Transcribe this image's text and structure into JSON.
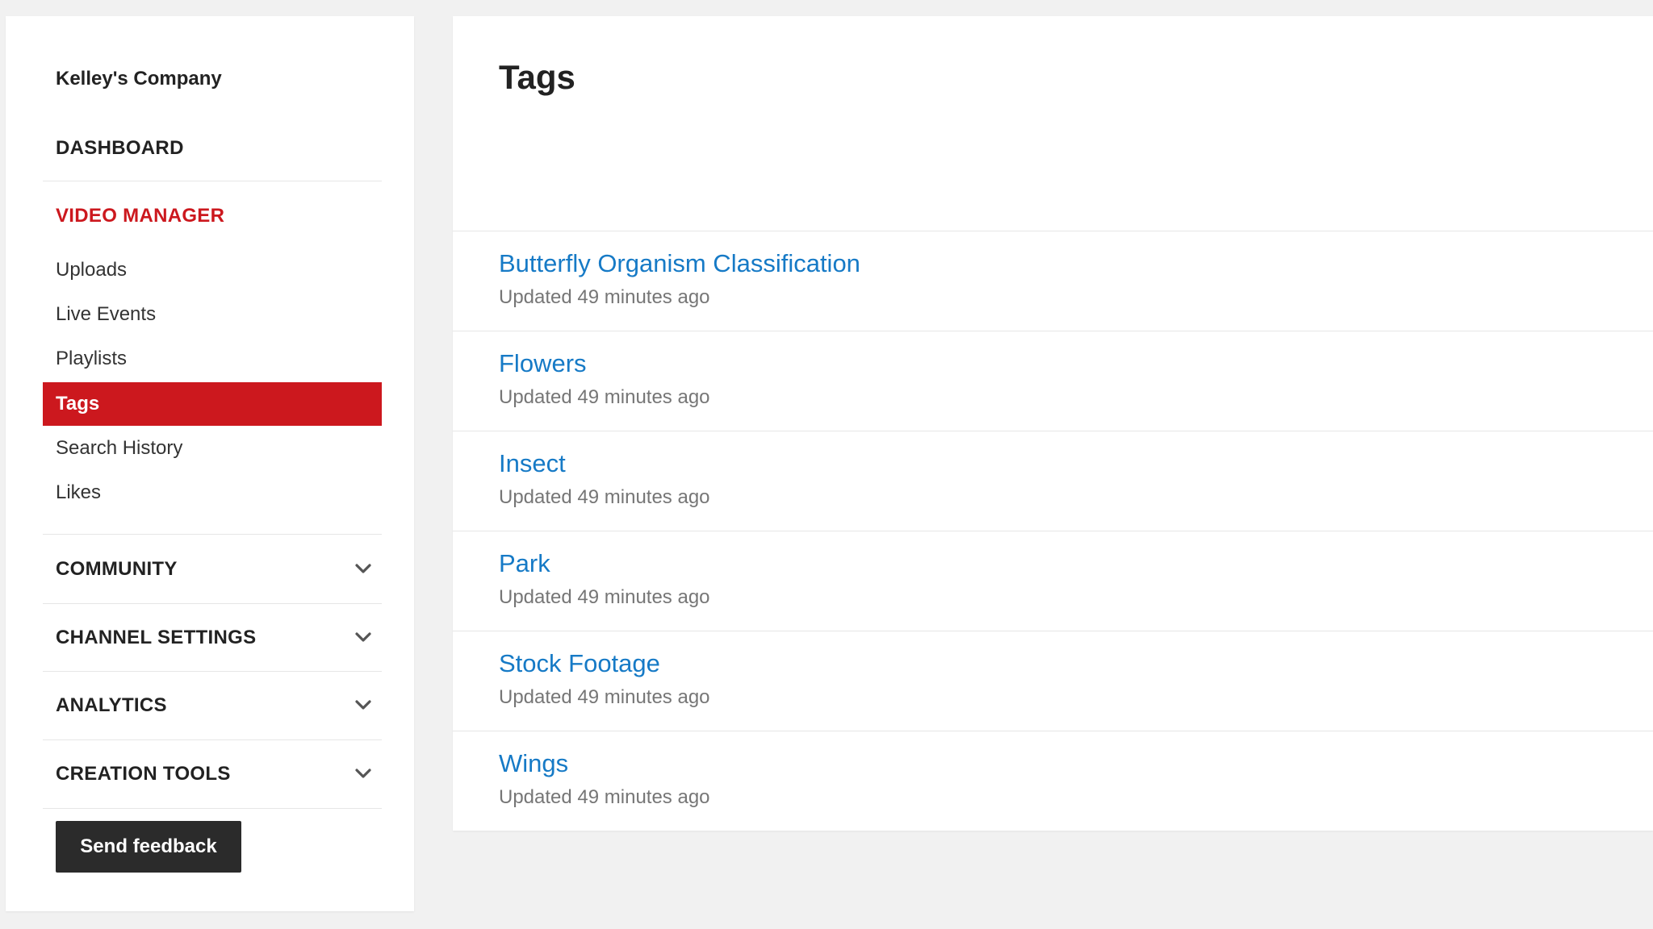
{
  "sidebar": {
    "company": "Kelley's Company",
    "dashboard": "DASHBOARD",
    "video_manager": "VIDEO MANAGER",
    "items": [
      {
        "label": "Uploads"
      },
      {
        "label": "Live Events"
      },
      {
        "label": "Playlists"
      },
      {
        "label": "Tags",
        "active": true
      },
      {
        "label": "Search History"
      },
      {
        "label": "Likes"
      }
    ],
    "sections": [
      {
        "label": "COMMUNITY",
        "icon": "chevron-down-icon"
      },
      {
        "label": "CHANNEL SETTINGS",
        "icon": "chevron-down-icon"
      },
      {
        "label": "ANALYTICS",
        "icon": "chevron-down-icon"
      },
      {
        "label": "CREATION TOOLS",
        "icon": "chevron-down-icon"
      }
    ],
    "feedback_label": "Send feedback"
  },
  "main": {
    "title": "Tags",
    "tags": [
      {
        "name": "Butterfly Organism Classification",
        "updated": "Updated 49 minutes ago"
      },
      {
        "name": "Flowers",
        "updated": "Updated 49 minutes ago"
      },
      {
        "name": "Insect",
        "updated": "Updated 49 minutes ago"
      },
      {
        "name": "Park",
        "updated": "Updated 49 minutes ago"
      },
      {
        "name": "Stock Footage",
        "updated": "Updated 49 minutes ago"
      },
      {
        "name": "Wings",
        "updated": "Updated 49 minutes ago"
      }
    ]
  },
  "colors": {
    "accent_red": "#cc181e",
    "link_blue": "#167ac6",
    "meta_gray": "#767676",
    "button_dark": "#2b2b2b"
  }
}
